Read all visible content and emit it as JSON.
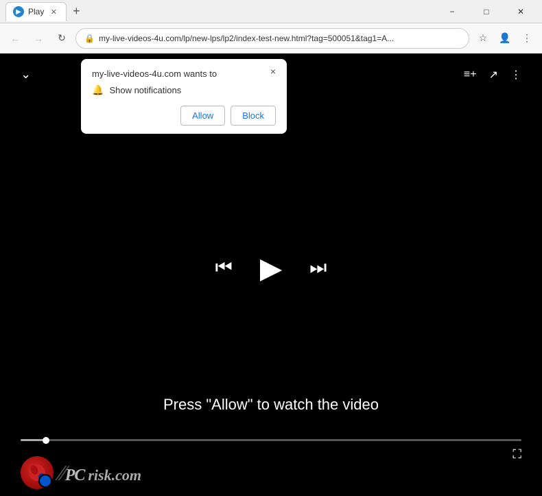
{
  "titlebar": {
    "tab_title": "Play",
    "new_tab_label": "+",
    "minimize_label": "−",
    "maximize_label": "□",
    "close_label": "✕"
  },
  "addressbar": {
    "back_label": "←",
    "forward_label": "→",
    "reload_label": "↻",
    "url": "my-live-videos-4u.com/lp/new-lps/lp2/index-test-new.html?tag=500051&tag1=A...",
    "star_label": "☆",
    "profile_label": "👤",
    "menu_label": "⋮"
  },
  "notification": {
    "site": "my-live-videos-4u.com wants to",
    "close_label": "×",
    "item_text": "Show notifications",
    "allow_label": "Allow",
    "block_label": "Block"
  },
  "player": {
    "chevron_label": "⌄",
    "queue_icon": "≡+",
    "share_icon": "↗",
    "more_icon": "⋮",
    "prev_label": "⏮",
    "play_label": "▶",
    "next_label": "⏭",
    "fullscreen_label": "⛶",
    "message": "Press \"Allow\" to watch the video",
    "progress_percent": 5
  },
  "watermark": {
    "text_gray": "risk.com",
    "text_white": "PC"
  }
}
